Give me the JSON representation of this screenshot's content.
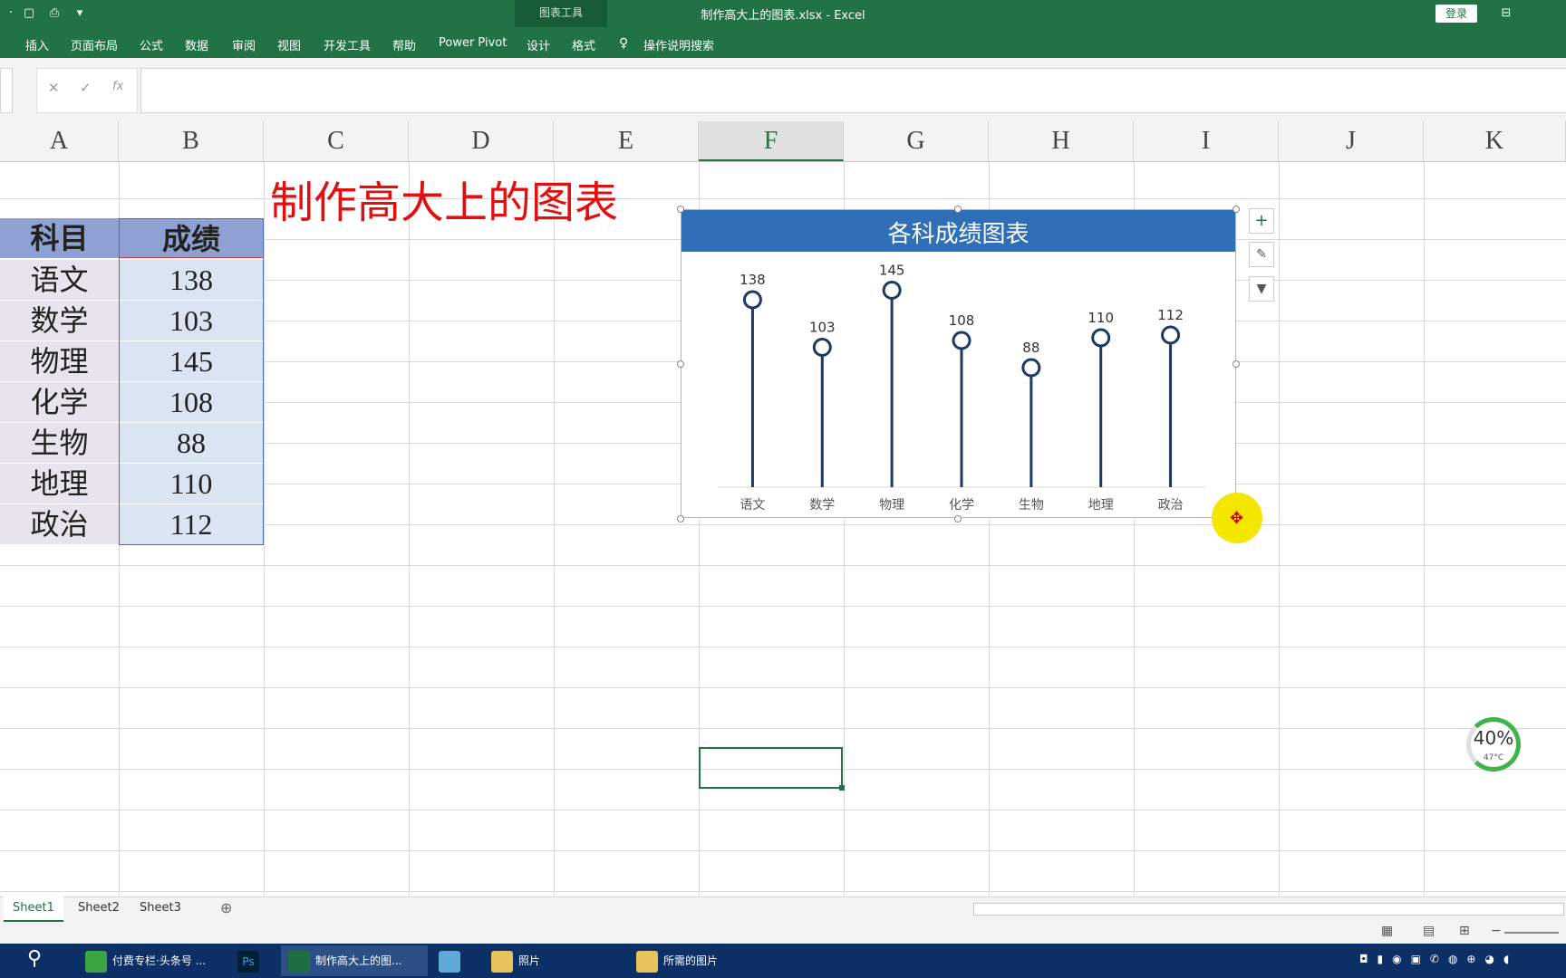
{
  "window": {
    "doc_title": "制作高大上的图表.xlsx  -  Excel",
    "context_tools": "图表工具",
    "login": "登录"
  },
  "ribbon_tabs": [
    "插入",
    "页面布局",
    "公式",
    "数据",
    "审阅",
    "视图",
    "开发工具",
    "帮助",
    "Power Pivot",
    "设计",
    "格式"
  ],
  "search_hint": "操作说明搜索",
  "formula_bar": {
    "cancel": "✕",
    "enter": "✓",
    "fx": "fx",
    "value": ""
  },
  "columns": [
    "A",
    "B",
    "C",
    "D",
    "E",
    "F",
    "G",
    "H",
    "I",
    "J",
    "K"
  ],
  "sheet": {
    "title": "制作高大上的图表",
    "header": {
      "subject": "科目",
      "score": "成绩"
    },
    "rows": [
      {
        "subject": "语文",
        "score": "138"
      },
      {
        "subject": "数学",
        "score": "103"
      },
      {
        "subject": "物理",
        "score": "145"
      },
      {
        "subject": "化学",
        "score": "108"
      },
      {
        "subject": "生物",
        "score": "88"
      },
      {
        "subject": "地理",
        "score": "110"
      },
      {
        "subject": "政治",
        "score": "112"
      }
    ]
  },
  "chart_data": {
    "type": "lollipop",
    "title": "各科成绩图表",
    "categories": [
      "语文",
      "数学",
      "物理",
      "化学",
      "生物",
      "地理",
      "政治"
    ],
    "values": [
      138,
      103,
      145,
      108,
      88,
      110,
      112
    ],
    "ylim": [
      0,
      160
    ],
    "grid": false,
    "line_color": "#1f3864"
  },
  "sheet_tabs": [
    "Sheet1",
    "Sheet2",
    "Sheet3"
  ],
  "taskbar": [
    {
      "label": "付费专栏·头条号 ...",
      "icon": "browser-icon",
      "color": "#3aa542"
    },
    {
      "label": "Ps",
      "icon": "photoshop-icon",
      "color": "#001e36"
    },
    {
      "label": "制作高大上的图...",
      "icon": "excel-icon",
      "color": "#1d6f42"
    },
    {
      "label": "",
      "icon": "app-icon",
      "color": "#5fa9d8"
    },
    {
      "label": "照片",
      "icon": "folder-icon",
      "color": "#e8c25a"
    },
    {
      "label": "所需的图片",
      "icon": "folder-icon",
      "color": "#e8c25a"
    }
  ],
  "cpu": {
    "percent": "40%",
    "temp": "47°C"
  }
}
